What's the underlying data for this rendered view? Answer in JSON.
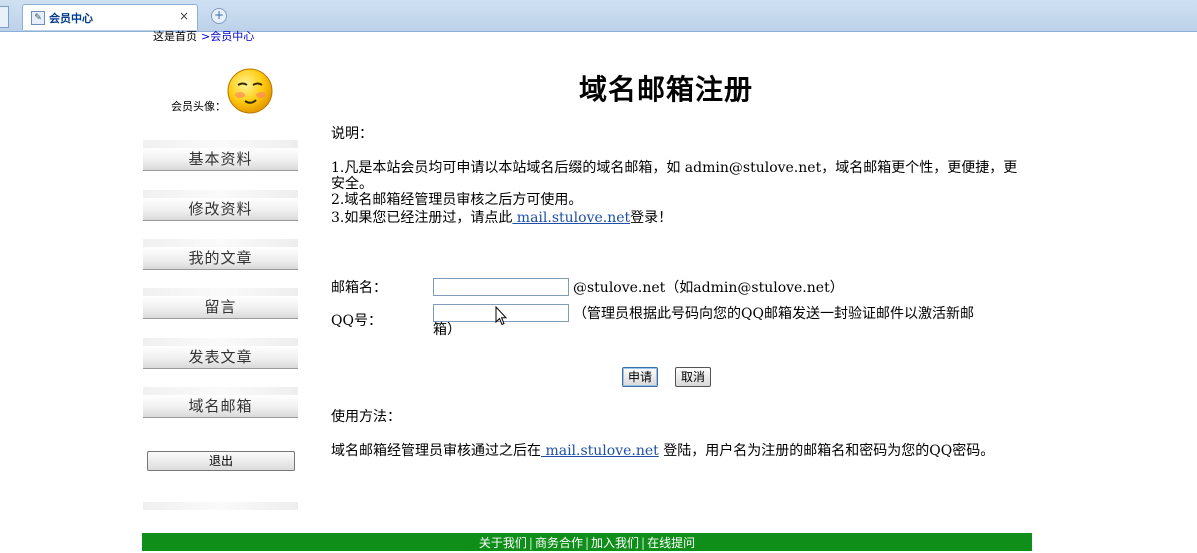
{
  "browser": {
    "tab_title": "会员中心",
    "tab_close": "×",
    "new_tab": "+"
  },
  "breadcrumb": {
    "home": "这是首页",
    "current": ">会员中心"
  },
  "sidebar": {
    "avatar_label": "会员头像：",
    "items": [
      {
        "label": "基本资料"
      },
      {
        "label": "修改资料"
      },
      {
        "label": "我的文章"
      },
      {
        "label": "留言"
      },
      {
        "label": "发表文章"
      },
      {
        "label": "域名邮箱"
      }
    ],
    "logout_label": "退出"
  },
  "main": {
    "title": "域名邮箱注册",
    "intro_heading": "说明：",
    "note1_a": "1.凡是本站会员均可申请以本站域名后缀的域名邮箱，如 admin@stulove.net，域名邮箱更个性，更便捷，更",
    "note1_b": "安全。",
    "note2": "2.域名邮箱经管理员审核之后方可使用。",
    "note3_prefix": "3.如果您已经注册过，请点此",
    "note3_link": " mail.stulove.net",
    "note3_suffix": "登录！",
    "form": {
      "mailbox_label": "邮箱名：",
      "mailbox_value": "",
      "mailbox_suffix": "@stulove.net（如admin@stulove.net）",
      "qq_label": "QQ号：",
      "qq_value": "",
      "qq_hint_a": "（管理员根据此号码向您的QQ邮箱发送一封验证邮件以激活新邮",
      "qq_hint_b": "箱）",
      "submit_label": "申请",
      "cancel_label": "取消"
    },
    "usage_heading": "使用方法：",
    "usage_prefix": "域名邮箱经管理员审核通过之后在",
    "usage_link": " mail.stulove.net",
    "usage_suffix": " 登陆，用户名为注册的邮箱名和密码为您的QQ密码。"
  },
  "footer": {
    "links": [
      "关于我们",
      "商务合作",
      "加入我们",
      "在线提问"
    ]
  }
}
